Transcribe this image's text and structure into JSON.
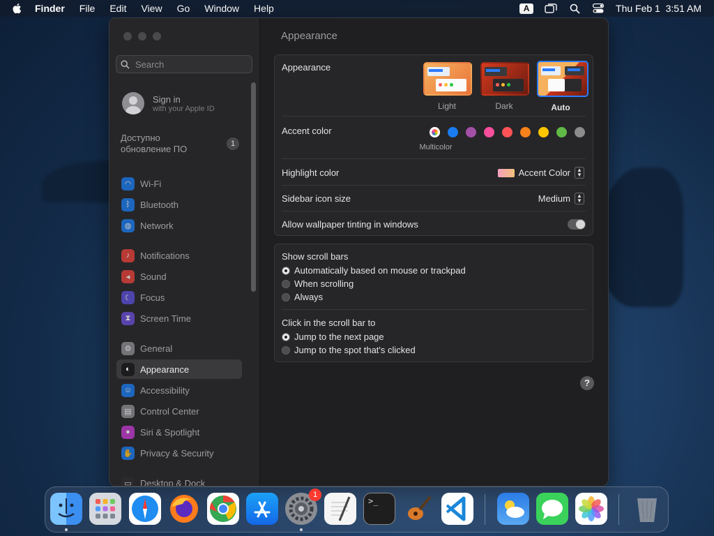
{
  "menubar": {
    "app": "Finder",
    "items": [
      "File",
      "Edit",
      "View",
      "Go",
      "Window",
      "Help"
    ],
    "input_badge": "A",
    "clock": "Thu Feb 1  3:51 AM"
  },
  "sidebar": {
    "search_placeholder": "Search",
    "signin_title": "Sign in",
    "signin_sub": "with your Apple ID",
    "update_line1": "Доступно",
    "update_line2": "обновление ПО",
    "update_badge": "1",
    "items": [
      {
        "label": "Wi-Fi",
        "icon": "wifi-icon",
        "color": "#1a7cf0"
      },
      {
        "label": "Bluetooth",
        "icon": "bluetooth-icon",
        "color": "#1a7cf0"
      },
      {
        "label": "Network",
        "icon": "globe-icon",
        "color": "#1a7cf0"
      },
      {
        "label": "Notifications",
        "icon": "bell-icon",
        "color": "#e8413a"
      },
      {
        "label": "Sound",
        "icon": "speaker-icon",
        "color": "#e8413a"
      },
      {
        "label": "Focus",
        "icon": "moon-icon",
        "color": "#5b4fd8"
      },
      {
        "label": "Screen Time",
        "icon": "hourglass-icon",
        "color": "#6b4fd8"
      },
      {
        "label": "General",
        "icon": "gear-icon",
        "color": "#8e8e93"
      },
      {
        "label": "Appearance",
        "icon": "appearance-icon",
        "color": "#1c1c1e",
        "selected": true
      },
      {
        "label": "Accessibility",
        "icon": "accessibility-icon",
        "color": "#1a7cf0"
      },
      {
        "label": "Control Center",
        "icon": "control-center-icon",
        "color": "#8e8e93"
      },
      {
        "label": "Siri & Spotlight",
        "icon": "siri-icon",
        "color": "#c43bd1"
      },
      {
        "label": "Privacy & Security",
        "icon": "hand-icon",
        "color": "#1a7cf0"
      },
      {
        "label": "Desktop & Dock",
        "icon": "desktop-icon",
        "color": "#2c2c2e"
      }
    ]
  },
  "content": {
    "title": "Appearance",
    "appearance_label": "Appearance",
    "themes": [
      {
        "label": "Light",
        "selected": false
      },
      {
        "label": "Dark",
        "selected": false
      },
      {
        "label": "Auto",
        "selected": true
      }
    ],
    "accent_label": "Accent color",
    "accent_selected_name": "Multicolor",
    "accent_colors": [
      "#ffffff",
      "#1a7cf0",
      "#a550a7",
      "#f74f9e",
      "#ff5257",
      "#f7821b",
      "#ffc600",
      "#62ba46",
      "#8c8c8c"
    ],
    "highlight_label": "Highlight color",
    "highlight_value": "Accent Color",
    "icon_size_label": "Sidebar icon size",
    "icon_size_value": "Medium",
    "tinting_label": "Allow wallpaper tinting in windows",
    "tinting_on": false,
    "scrollbars_label": "Show scroll bars",
    "scrollbars_options": [
      {
        "label": "Automatically based on mouse or trackpad",
        "selected": true
      },
      {
        "label": "When scrolling",
        "selected": false
      },
      {
        "label": "Always",
        "selected": false
      }
    ],
    "click_label": "Click in the scroll bar to",
    "click_options": [
      {
        "label": "Jump to the next page",
        "selected": true
      },
      {
        "label": "Jump to the spot that's clicked",
        "selected": false
      }
    ],
    "help": "?"
  },
  "dock": {
    "apps": [
      {
        "name": "finder",
        "running": true
      },
      {
        "name": "launchpad",
        "running": false
      },
      {
        "name": "safari",
        "running": false
      },
      {
        "name": "firefox",
        "running": false
      },
      {
        "name": "chrome",
        "running": false
      },
      {
        "name": "app-store",
        "running": false
      },
      {
        "name": "system-settings",
        "running": true,
        "badge": "1"
      },
      {
        "name": "textedit",
        "running": false
      },
      {
        "name": "terminal",
        "running": false
      },
      {
        "name": "garageband",
        "running": false
      },
      {
        "name": "vscode",
        "running": false
      },
      {
        "name": "weather",
        "running": false
      },
      {
        "name": "messages",
        "running": false
      },
      {
        "name": "photos",
        "running": false
      },
      {
        "name": "trash",
        "running": false
      }
    ],
    "terminal_prompt": ">_"
  }
}
